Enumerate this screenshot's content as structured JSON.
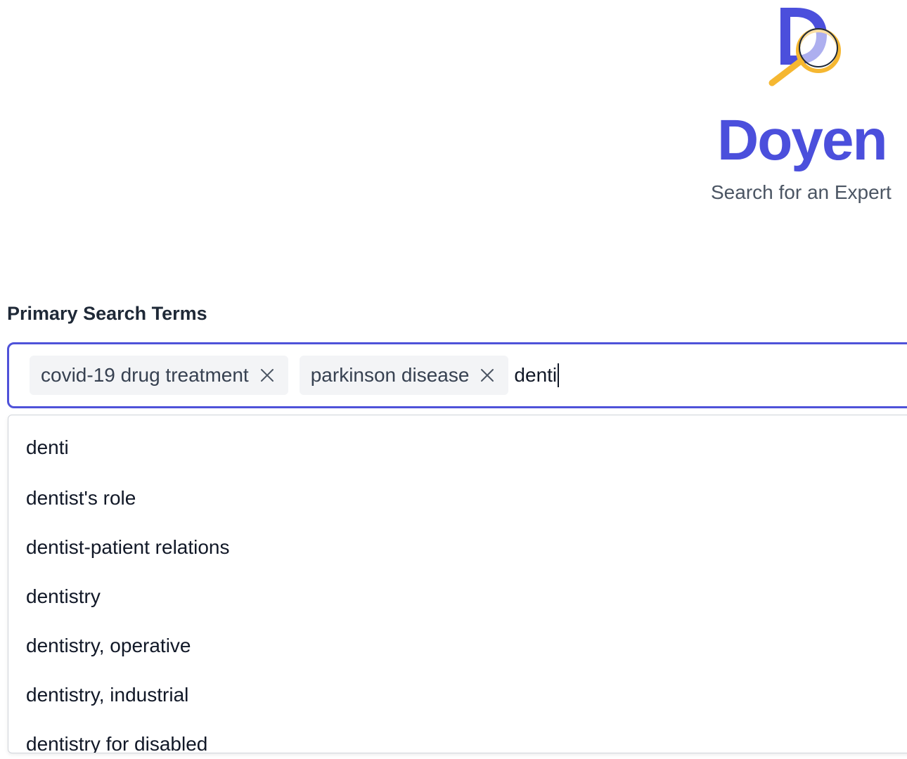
{
  "brand": {
    "name": "Doyen",
    "tagline": "Search for an Expert",
    "logo_icon": "magnifier-d-logo",
    "color": "#4b4fdc",
    "accent": "#f5b731"
  },
  "search": {
    "label": "Primary Search Terms",
    "chips": [
      {
        "label": "covid-19 drug treatment",
        "remove_icon": "close-icon"
      },
      {
        "label": "parkinson disease",
        "remove_icon": "close-icon"
      }
    ],
    "typed_value": "denti",
    "focus_border_color": "#4f52d9"
  },
  "suggestions": [
    "denti",
    "dentist's role",
    "dentist-patient relations",
    "dentistry",
    "dentistry, operative",
    "dentistry, industrial",
    "dentistry for disabled"
  ]
}
